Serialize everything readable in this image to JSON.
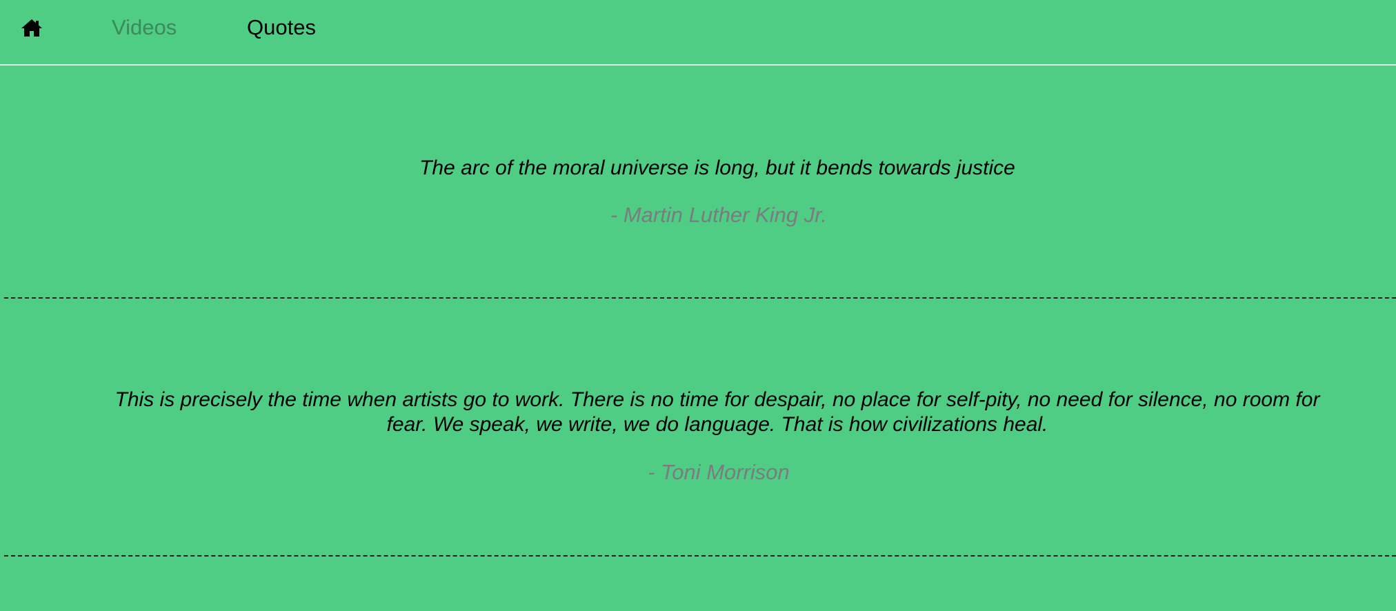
{
  "nav": {
    "home_icon": "home-icon",
    "videos_label": "Videos",
    "quotes_label": "Quotes",
    "videos_color": "#3c8a57",
    "active_color": "#000000"
  },
  "quotes": [
    {
      "text": "The arc of the moral universe is long, but it bends towards justice",
      "author": "- Martin Luther King Jr."
    },
    {
      "text": "This is precisely the time when artists go to work. There is no time for despair, no place for self-pity, no need for silence, no room for fear. We speak, we write, we do language. That is how civilizations heal.",
      "author": "- Toni Morrison"
    }
  ],
  "colors": {
    "background": "#50cd84",
    "author": "#7b7b80",
    "quote": "#000000"
  }
}
